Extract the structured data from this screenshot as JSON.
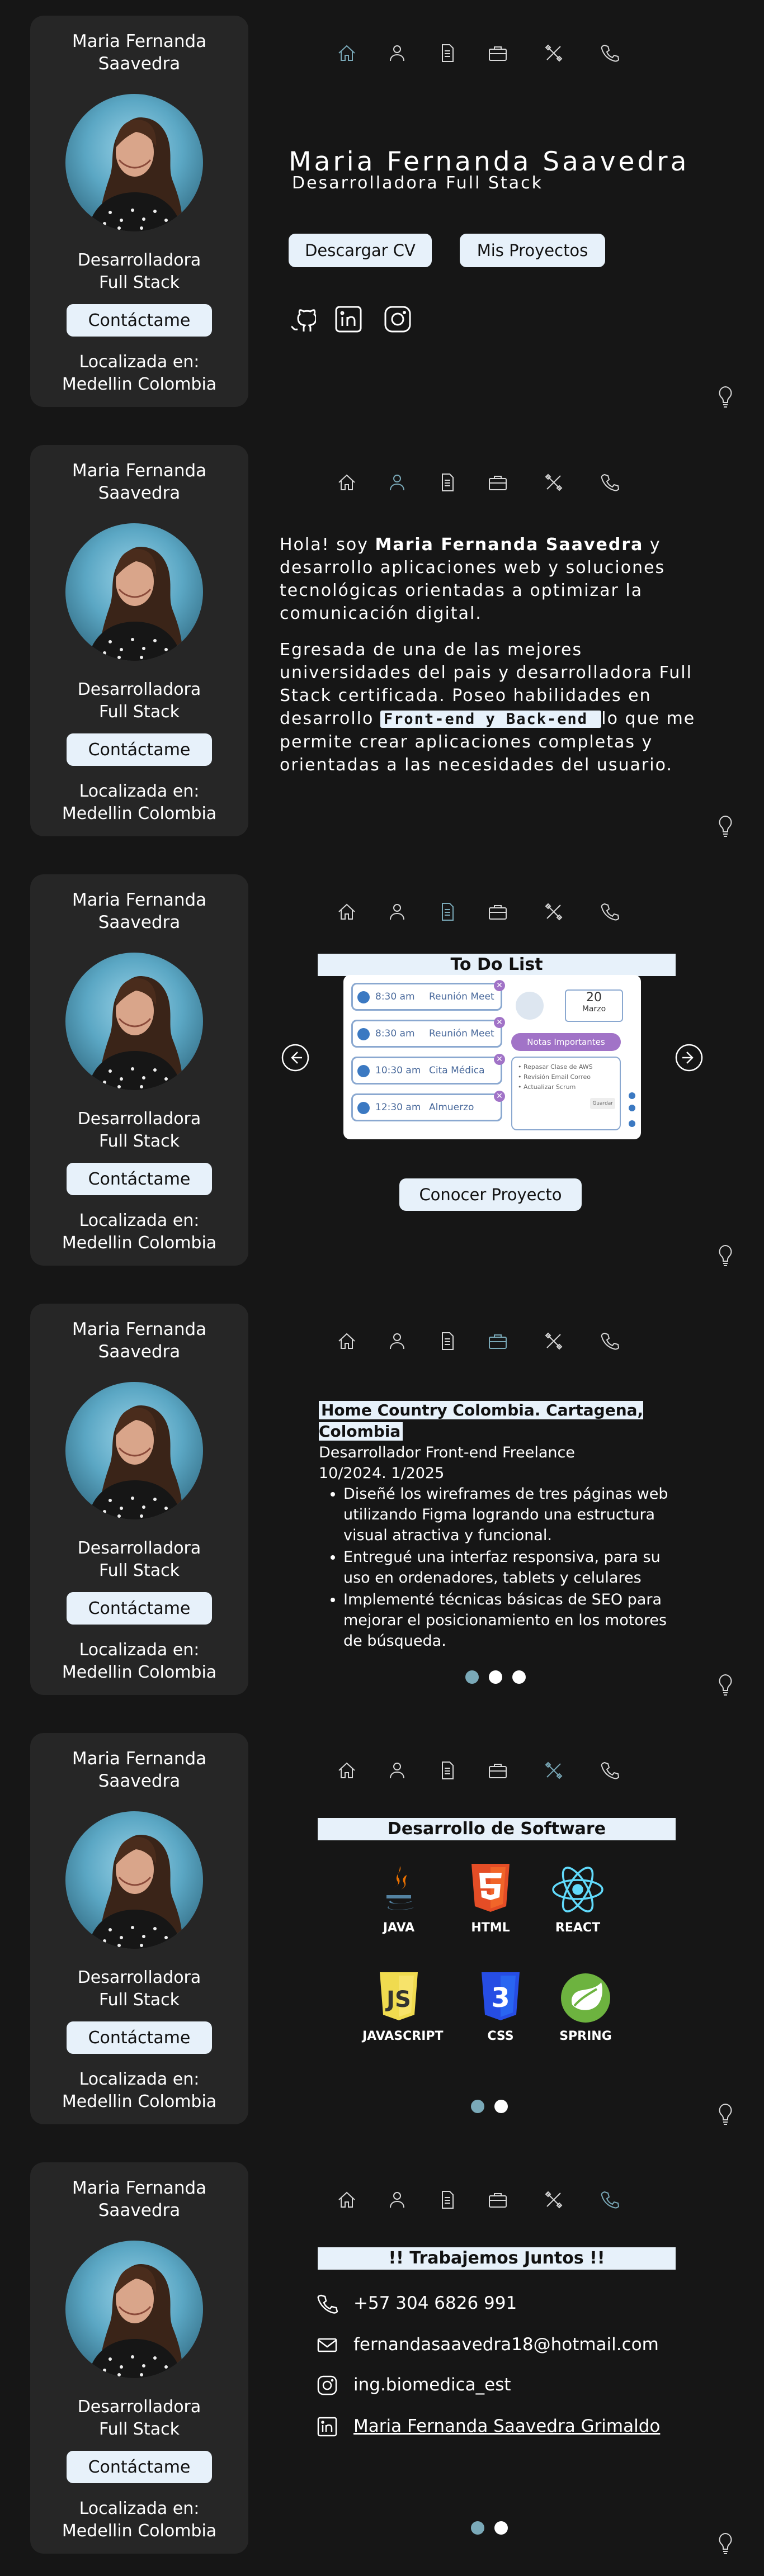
{
  "profile": {
    "name_line1": "Maria Fernanda",
    "name_line2": "Saavedra",
    "role_line1": "Desarrolladora",
    "role_line2": "Full Stack",
    "contact_button": "Contáctame",
    "location_line1": "Localizada en:",
    "location_line2": "Medellin Colombia"
  },
  "nav": {
    "items": [
      "home-icon",
      "user-icon",
      "document-icon",
      "briefcase-icon",
      "tools-icon",
      "phone-icon"
    ]
  },
  "hero": {
    "name": "Maria Fernanda Saavedra",
    "role": "Desarrolladora Full Stack",
    "cv_button": "Descargar CV",
    "projects_button": "Mis Proyectos",
    "social": [
      "github-icon",
      "linkedin-icon",
      "instagram-icon"
    ]
  },
  "about": {
    "p1_prefix": "Hola! soy ",
    "p1_name": "Maria Fernanda Saavedra",
    "p1_suffix": " y desarrollo aplicaciones web y soluciones tecnológicas orientadas a optimizar la comunicación digital.",
    "p2_prefix": "Egresada de una de las mejores universidades del pais y desarrolladora Full Stack certificada. Poseo habilidades en desarrollo ",
    "p2_highlight": "Front-end y Back-end ",
    "p2_suffix": " lo que me permite crear aplicaciones completas y orientadas a las necesidades del usuario."
  },
  "project": {
    "title": "To Do List",
    "button": "Conocer Proyecto",
    "tasks": [
      {
        "time": "8:30 am",
        "title": "Reunión Meet"
      },
      {
        "time": "8:30 am",
        "title": "Reunión Meet"
      },
      {
        "time": "10:30 am",
        "title": "Cita Médica"
      },
      {
        "time": "12:30 am",
        "title": "Almuerzo"
      }
    ],
    "date_day": "20",
    "date_month": "Marzo",
    "notes_label": "Notas Importantes",
    "notes": [
      "Repasar Clase de AWS",
      "Revisión Email Correo",
      "Actualizar Scrum"
    ],
    "save_label": "Guardar"
  },
  "experience": {
    "company": "Home Country Colombia. Cartagena, Colombia",
    "position": "Desarrollador Front-end  Freelance",
    "period": "10/2024. 1/2025",
    "bullets": [
      "Diseñé los wireframes de tres páginas web utilizando Figma logrando una estructura visual atractiva y funcional.",
      "Entregué una interfaz responsiva, para su uso en ordenadores, tablets y celulares",
      "Implementé técnicas básicas de SEO para mejorar el posicionamiento en los motores de búsqueda."
    ]
  },
  "skills": {
    "title": "Desarrollo de Software",
    "items": [
      {
        "label": "JAVA",
        "color": "#e76f00"
      },
      {
        "label": "HTML",
        "color": "#e44d26"
      },
      {
        "label": "REACT",
        "color": "#61dafb"
      },
      {
        "label": "JAVASCRIPT",
        "color": "#f0db4f"
      },
      {
        "label": "CSS",
        "color": "#264de4"
      },
      {
        "label": "SPRING",
        "color": "#6db33f"
      }
    ]
  },
  "contact": {
    "title": "!! Trabajemos Juntos !!",
    "phone": "+57 304 6826 991",
    "email": "fernandasaavedra18@hotmail.com",
    "instagram": "ing.biomedica_est",
    "linkedin": "Maria Fernanda Saavedra Grimaldo"
  },
  "colors": {
    "background": "#161616",
    "card": "#262626",
    "accent": "#7aa9b8",
    "button": "#e7f1fa"
  }
}
